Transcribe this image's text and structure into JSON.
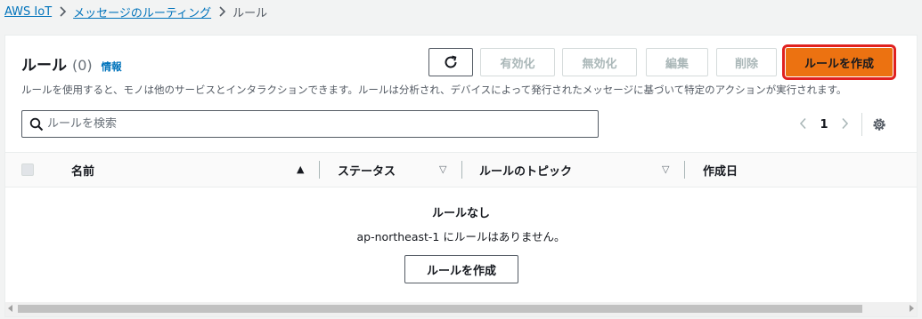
{
  "breadcrumb": {
    "root": "AWS IoT",
    "parent": "メッセージのルーティング",
    "current": "ルール"
  },
  "header": {
    "title": "ルール",
    "count": "(0)",
    "info": "情報",
    "description": "ルールを使用すると、モノは他のサービスとインタラクションできます。ルールは分析され、デバイスによって発行されたメッセージに基づいて特定のアクションが実行されます。"
  },
  "toolbar": {
    "enable_label": "有効化",
    "disable_label": "無効化",
    "edit_label": "編集",
    "delete_label": "削除",
    "create_label": "ルールを作成"
  },
  "search": {
    "placeholder": "ルールを検索",
    "value": ""
  },
  "pagination": {
    "page": "1"
  },
  "table": {
    "columns": [
      "名前",
      "ステータス",
      "ルールのトピック",
      "作成日"
    ]
  },
  "empty_state": {
    "title": "ルールなし",
    "message": "ap-northeast-1 にルールはありません。",
    "button_label": "ルールを作成"
  },
  "colors": {
    "primary": "#ec7211",
    "highlight": "#e0211f",
    "link": "#0073bb"
  }
}
